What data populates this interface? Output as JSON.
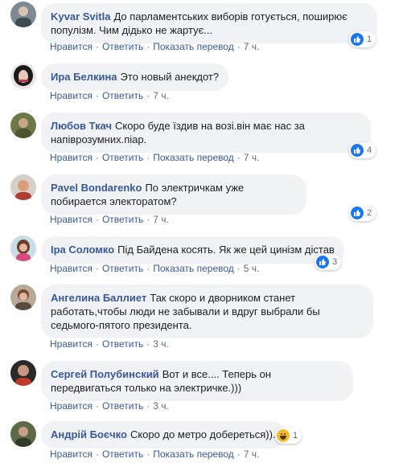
{
  "actions": {
    "like": "Нравится",
    "reply": "Ответить",
    "translate": "Показать перевод"
  },
  "comments": [
    {
      "author": "Kyvar Svitla",
      "text": "До парламентських виборів готується, поширює популізм. Чим дідько не жартує...",
      "time": "7 ч.",
      "reactions": "1",
      "reaction_type": "like",
      "has_translate": true
    },
    {
      "author": "Ира Белкина",
      "text": "Это новый анекдот?",
      "time": "7 ч.",
      "reactions": "",
      "reaction_type": "",
      "has_translate": false
    },
    {
      "author": "Любов Ткач",
      "text": "Скоро буде їздив на возі.він має нас за напіврозумних.піар.",
      "time": "7 ч.",
      "reactions": "4",
      "reaction_type": "like",
      "has_translate": true
    },
    {
      "author": "Pavel Bondarenko",
      "text": "По электричкам уже побирается электоратом?",
      "time": "7 ч.",
      "reactions": "2",
      "reaction_type": "like",
      "has_translate": false
    },
    {
      "author": "Іра Соломко",
      "text": "Під Байдена косять. Як же цей цинізм дістав",
      "time": "5 ч.",
      "reactions": "3",
      "reaction_type": "like",
      "has_translate": true
    },
    {
      "author": "Ангелина Баллиет",
      "text": "Так скоро и дворником станет работать,чтобы люди не забывали и вдруг выбрали бы седьмого-пятого президента.",
      "time": "3 ч.",
      "reactions": "",
      "reaction_type": "",
      "has_translate": false
    },
    {
      "author": "Сергей Полубинский",
      "text": "Вот и все.... Теперь он передвигаться только на электричке.)))",
      "time": "3 ч.",
      "reactions": "",
      "reaction_type": "",
      "has_translate": false
    },
    {
      "author": "Андрій Боєчко",
      "text": "Скоро до метро добереться)).",
      "time": "7 ч.",
      "reactions": "1",
      "reaction_type": "haha",
      "has_translate": true
    }
  ]
}
